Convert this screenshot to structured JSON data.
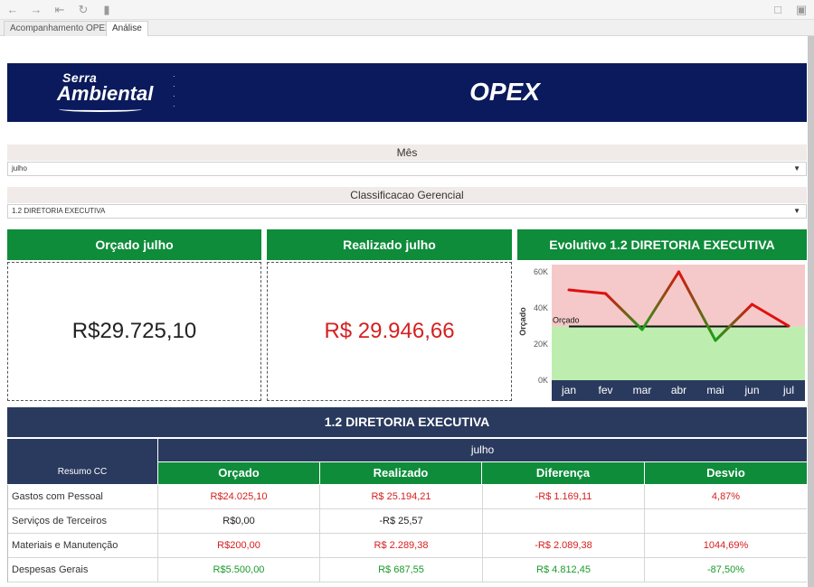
{
  "toolbar": {
    "icons": [
      "undo-icon",
      "redo-icon",
      "revert-icon",
      "refresh-icon",
      "pause-icon",
      "comment-icon",
      "fullscreen-icon"
    ]
  },
  "tabs": [
    {
      "label": "Acompanhamento OPEX",
      "active": false
    },
    {
      "label": "Análise",
      "active": true
    }
  ],
  "header": {
    "logo_line1": "Serra",
    "logo_line2": "Ambiental",
    "title": "OPEX",
    "color": "#0a1a5c"
  },
  "filters": {
    "month": {
      "title": "Mês",
      "value": "julho"
    },
    "classification": {
      "title": "Classificacao Gerencial",
      "value": "1.2 DIRETORIA EXECUTIVA"
    }
  },
  "kpis": {
    "orcado": {
      "title": "Orçado julho",
      "value": "R$29.725,10"
    },
    "realizado": {
      "title": "Realizado julho",
      "value": "R$ 29.946,66"
    }
  },
  "chart_title": "Evolutivo 1.2 DIRETORIA EXECUTIVA",
  "chart_data": {
    "type": "line",
    "x": [
      "jan",
      "fev",
      "mar",
      "abr",
      "mai",
      "jun",
      "jul"
    ],
    "series": [
      {
        "values": [
          50000,
          48000,
          28000,
          60000,
          22000,
          42000,
          30000
        ]
      }
    ],
    "reference_line": {
      "label": "Orçado",
      "value": 29725.1
    },
    "ylabel": "Orçado",
    "yticks": [
      "0K",
      "20K",
      "40K",
      "60K"
    ],
    "ylim": [
      0,
      64000
    ],
    "colors": {
      "above": "#f5c9c9",
      "below": "#bdeeb0",
      "line_high": "#e01010",
      "line_low": "#1aa01a"
    },
    "grid": false
  },
  "table": {
    "section_title": "1.2 DIRETORIA EXECUTIVA",
    "row_header": "Resumo CC",
    "month": "julho",
    "columns": [
      "Orçado",
      "Realizado",
      "Diferença",
      "Desvio"
    ],
    "rows": [
      {
        "label": "Gastos com Pessoal",
        "cells": [
          "R$24.025,10",
          "R$ 25.194,21",
          "-R$ 1.169,11",
          "4,87%"
        ],
        "colors": [
          "red",
          "red",
          "red",
          "red"
        ]
      },
      {
        "label": "Serviços de Terceiros",
        "cells": [
          "R$0,00",
          "-R$ 25,57",
          "",
          ""
        ],
        "colors": [
          "black",
          "black",
          "black",
          "black"
        ]
      },
      {
        "label": "Materiais e Manutenção",
        "cells": [
          "R$200,00",
          "R$ 2.289,38",
          "-R$ 2.089,38",
          "1044,69%"
        ],
        "colors": [
          "red",
          "red",
          "red",
          "red"
        ]
      },
      {
        "label": "Despesas Gerais",
        "cells": [
          "R$5.500,00",
          "R$ 687,55",
          "R$ 4.812,45",
          "-87,50%"
        ],
        "colors": [
          "green",
          "green",
          "green",
          "green"
        ]
      }
    ]
  }
}
